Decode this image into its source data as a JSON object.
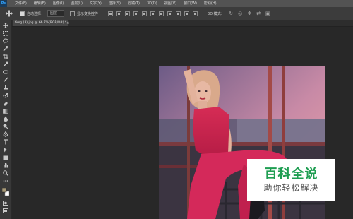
{
  "app": {
    "logo": "Ps"
  },
  "menubar": {
    "items": [
      "文件(F)",
      "编辑(E)",
      "图像(I)",
      "图层(L)",
      "文字(Y)",
      "选择(S)",
      "滤镜(T)",
      "3D(D)",
      "视图(V)",
      "窗口(W)",
      "帮助(H)"
    ]
  },
  "options": {
    "auto_select_label": "自动选择：",
    "auto_select_value": "图层",
    "show_transform_label": "显示变换控件",
    "mode_3d_label": "3D 模式："
  },
  "document": {
    "tab_title": "timg (3).jpg @ 66.7%(RGB/8#) *",
    "close_glyph": "×"
  },
  "watermark": {
    "brand": "百科全说",
    "tagline": "助你轻松解决"
  },
  "colors": {
    "menubar": "#535353",
    "optionsbar": "#3c3c3c",
    "toolbar": "#383838",
    "workspace": "#282828",
    "accent_green": "#1f9e52"
  },
  "icons": {
    "move": "move-icon",
    "marquee": "rectangular-marquee-icon",
    "lasso": "lasso-icon",
    "quick_select": "quick-selection-icon",
    "crop": "crop-icon",
    "eyedropper": "eyedropper-icon",
    "healing": "spot-healing-brush-icon",
    "brush": "brush-icon",
    "stamp": "clone-stamp-icon",
    "history": "history-brush-icon",
    "eraser": "eraser-icon",
    "gradient": "gradient-icon",
    "blur": "blur-icon",
    "dodge": "dodge-icon",
    "pen": "pen-icon",
    "type": "type-icon",
    "path_select": "path-selection-icon",
    "shape": "rectangle-shape-icon",
    "hand": "hand-icon",
    "zoom": "zoom-icon",
    "colors": "foreground-background-color-icon",
    "quick_mask": "quick-mask-icon",
    "screen_mode": "screen-mode-icon"
  }
}
